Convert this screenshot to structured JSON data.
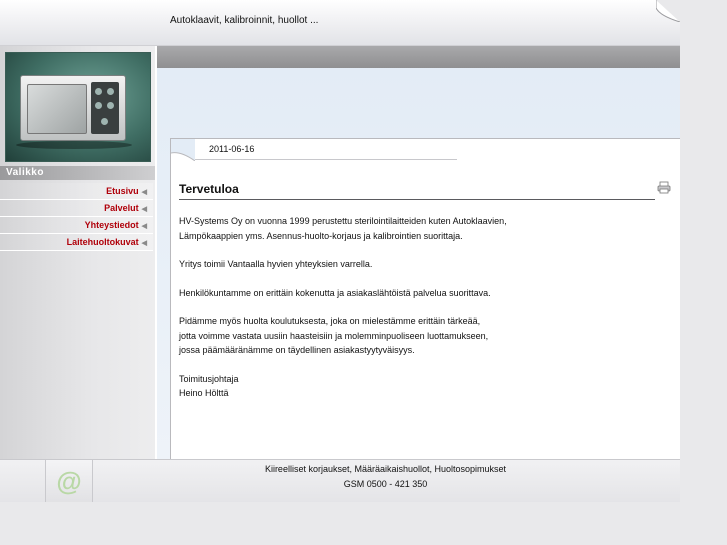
{
  "header": {
    "tagline": "Autoklaavit, kalibroinnit, huollot ..."
  },
  "sidebar": {
    "menu_title": "Valikko",
    "items": [
      {
        "label": "Etusivu"
      },
      {
        "label": "Palvelut"
      },
      {
        "label": "Yhteystiedot"
      },
      {
        "label": "Laitehuoltokuvat"
      }
    ]
  },
  "article": {
    "date": "2011-06-16",
    "title": "Tervetuloa",
    "paragraphs": [
      [
        "HV-Systems Oy on vuonna 1999 perustettu sterilointilaitteiden kuten Autoklaavien,",
        "Lämpökaappien yms. Asennus-huolto-korjaus ja kalibrointien suorittaja."
      ],
      [
        "Yritys toimii Vantaalla hyvien yhteyksien varrella."
      ],
      [
        "Henkilökuntamme on erittäin kokenutta ja asiakaslähtöistä palvelua suorittava."
      ],
      [
        "Pidämme myös huolta koulutuksesta, joka on mielestämme erittäin tärkeää,",
        "jotta voimme vastata uusiin haasteisiin ja molemminpuoliseen luottamukseen,",
        "jossa päämääränämme on täydellinen asiakastyytyväisyys."
      ],
      [
        "Toimitusjohtaja",
        "Heino Hölttä"
      ]
    ]
  },
  "footer": {
    "line1": "Kiireelliset korjaukset, Määräaikaishuollot, Huoltosopimukset",
    "line2": "GSM 0500 - 421 350",
    "at_symbol": "@"
  },
  "icons": {
    "menu_arrow": "arrow-left-icon",
    "print": "print-icon",
    "email": "at-icon"
  }
}
